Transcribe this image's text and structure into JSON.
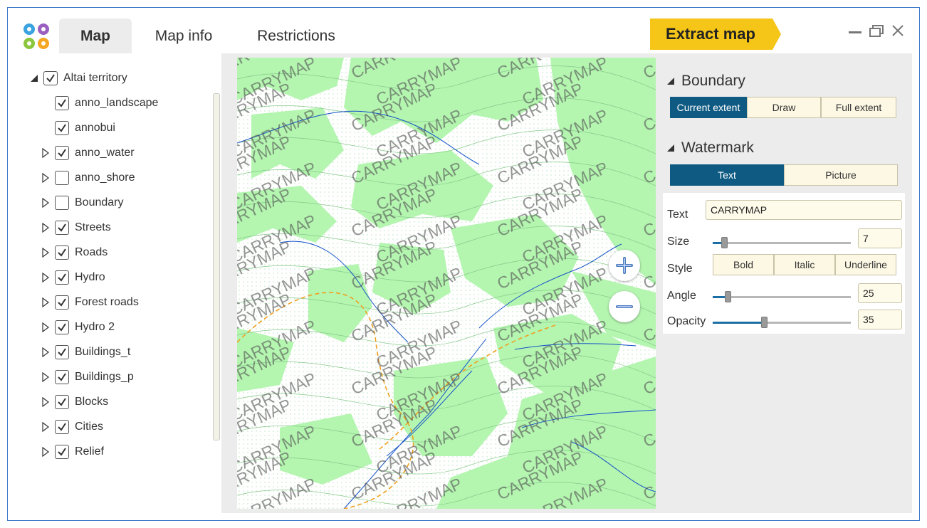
{
  "tabs": [
    {
      "label": "Map",
      "active": true
    },
    {
      "label": "Map info",
      "active": false
    },
    {
      "label": "Restrictions",
      "active": false
    }
  ],
  "extract_button": {
    "label": "Extract map",
    "color": "#f5c518"
  },
  "layers": [
    {
      "label": "Altai territory",
      "checked": true,
      "expander": "expanded",
      "level": 0
    },
    {
      "label": "anno_landscape",
      "checked": true,
      "expander": "none",
      "level": 1
    },
    {
      "label": "annobui",
      "checked": true,
      "expander": "none",
      "level": 1
    },
    {
      "label": "anno_water",
      "checked": true,
      "expander": "collapsed",
      "level": 1
    },
    {
      "label": "anno_shore",
      "checked": false,
      "expander": "collapsed",
      "level": 1
    },
    {
      "label": "Boundary",
      "checked": false,
      "expander": "collapsed",
      "level": 1
    },
    {
      "label": "Streets",
      "checked": true,
      "expander": "collapsed",
      "level": 1
    },
    {
      "label": "Roads",
      "checked": true,
      "expander": "collapsed",
      "level": 1
    },
    {
      "label": "Hydro",
      "checked": true,
      "expander": "collapsed",
      "level": 1
    },
    {
      "label": "Forest roads",
      "checked": true,
      "expander": "collapsed",
      "level": 1
    },
    {
      "label": "Hydro 2",
      "checked": true,
      "expander": "collapsed",
      "level": 1
    },
    {
      "label": "Buildings_t",
      "checked": true,
      "expander": "collapsed",
      "level": 1
    },
    {
      "label": "Buildings_p",
      "checked": true,
      "expander": "collapsed",
      "level": 1
    },
    {
      "label": "Blocks",
      "checked": true,
      "expander": "collapsed",
      "level": 1
    },
    {
      "label": "Cities",
      "checked": true,
      "expander": "collapsed",
      "level": 1
    },
    {
      "label": "Relief",
      "checked": true,
      "expander": "collapsed",
      "level": 1
    }
  ],
  "map": {
    "watermark_text": "CARRYMAP",
    "forest_color": "#b4f5b0",
    "water_color": "#1450c8",
    "road_color": "#f0a020"
  },
  "boundary": {
    "title": "Boundary",
    "options": [
      {
        "label": "Current extent",
        "active": true
      },
      {
        "label": "Draw",
        "active": false
      },
      {
        "label": "Full extent",
        "active": false
      }
    ]
  },
  "watermark": {
    "title": "Watermark",
    "modes": [
      {
        "label": "Text",
        "active": true
      },
      {
        "label": "Picture",
        "active": false
      }
    ],
    "text_label": "Text",
    "text_value": "CARRYMAP",
    "size_label": "Size",
    "size_value": "7",
    "size_fraction": 0.06,
    "style_label": "Style",
    "style_buttons": [
      "Bold",
      "Italic",
      "Underline"
    ],
    "angle_label": "Angle",
    "angle_value": "25",
    "angle_fraction": 0.09,
    "opacity_label": "Opacity",
    "opacity_value": "35",
    "opacity_fraction": 0.35
  },
  "accent_color": "#0f5a82"
}
